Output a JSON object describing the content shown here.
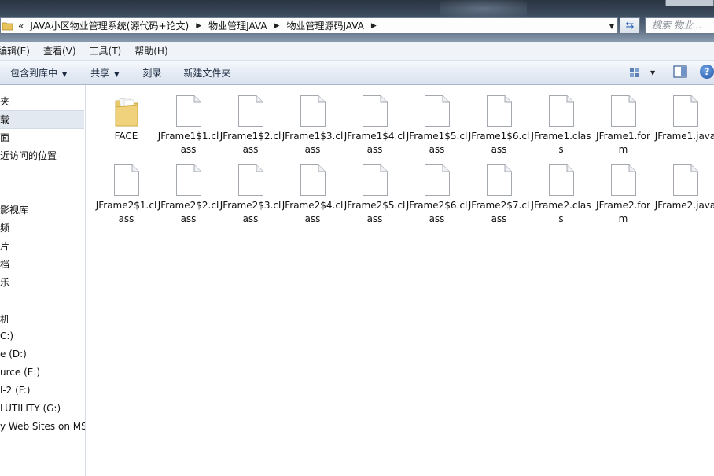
{
  "address": {
    "overflow": "«",
    "segments": [
      "JAVA小区物业管理系统(源代码+论文)",
      "物业管理JAVA",
      "物业管理源码JAVA"
    ]
  },
  "search": {
    "placeholder": "搜索 物业..."
  },
  "menubar": {
    "items": [
      "编辑(E)",
      "查看(V)",
      "工具(T)",
      "帮助(H)"
    ]
  },
  "commandbar": {
    "items": [
      "包含到库中",
      "共享",
      "刻录",
      "新建文件夹"
    ]
  },
  "help": {
    "label": "?"
  },
  "navpane": {
    "items": [
      "夹",
      "载",
      "面",
      "近访问的位置",
      "",
      "",
      "",
      "影视库",
      "频",
      "片",
      "档",
      "乐",
      "",
      "",
      "机",
      "C:)",
      "e (D:)",
      "urce (E:)",
      "l-2 (F:)",
      "LUTILITY (G:)",
      "y Web Sites on MSN"
    ]
  },
  "files": [
    {
      "name": "FACE",
      "type": "folder"
    },
    {
      "name": "JFrame1$1.class",
      "type": "file"
    },
    {
      "name": "JFrame1$2.class",
      "type": "file"
    },
    {
      "name": "JFrame1$3.class",
      "type": "file"
    },
    {
      "name": "JFrame1$4.class",
      "type": "file"
    },
    {
      "name": "JFrame1$5.class",
      "type": "file"
    },
    {
      "name": "JFrame1$6.class",
      "type": "file"
    },
    {
      "name": "JFrame1.class",
      "type": "file"
    },
    {
      "name": "JFrame1.form",
      "type": "file"
    },
    {
      "name": "JFrame1.java",
      "type": "file"
    },
    {
      "name": "JFrame2$1.class",
      "type": "file"
    },
    {
      "name": "JFrame2$2.class",
      "type": "file"
    },
    {
      "name": "JFrame2$3.class",
      "type": "file"
    },
    {
      "name": "JFrame2$4.class",
      "type": "file"
    },
    {
      "name": "JFrame2$5.class",
      "type": "file"
    },
    {
      "name": "JFrame2$6.class",
      "type": "file"
    },
    {
      "name": "JFrame2$7.class",
      "type": "file"
    },
    {
      "name": "JFrame2.class",
      "type": "file"
    },
    {
      "name": "JFrame2.form",
      "type": "file"
    },
    {
      "name": "JFrame2.java",
      "type": "file"
    }
  ]
}
